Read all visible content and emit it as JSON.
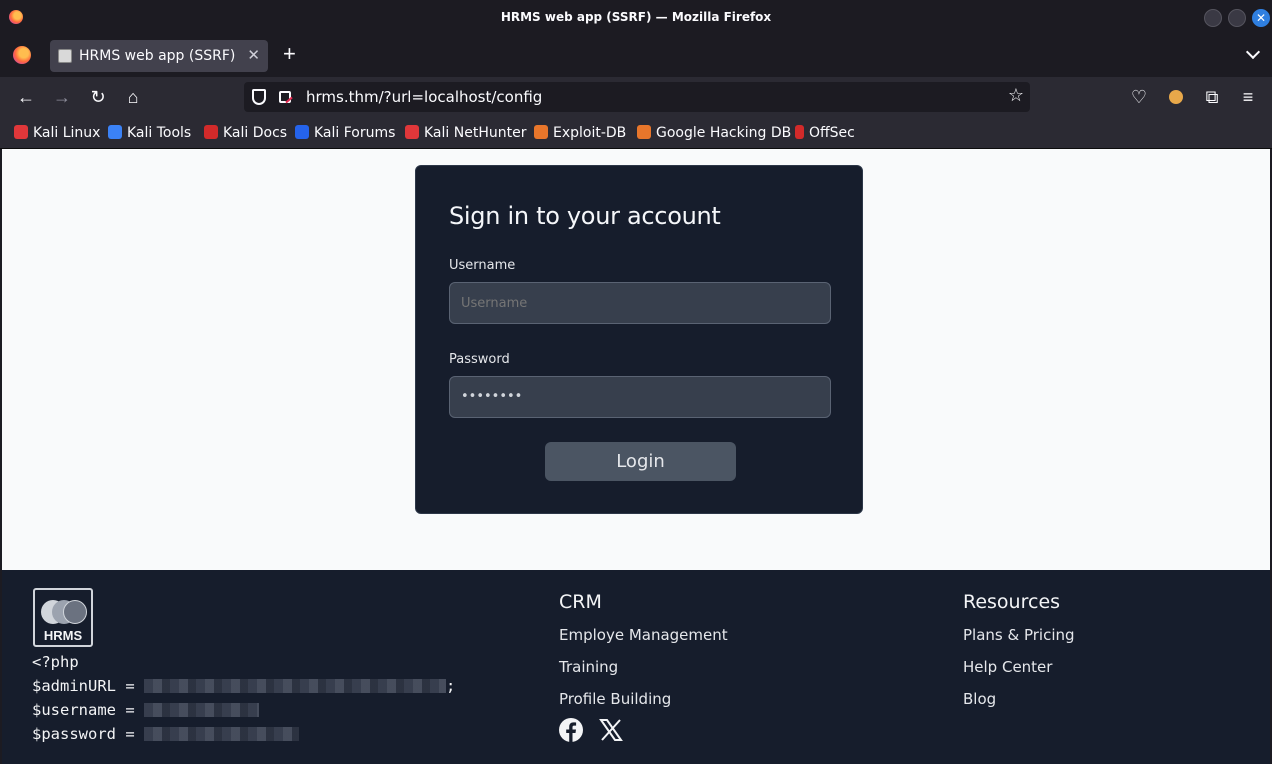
{
  "window": {
    "title": "HRMS web app (SSRF) — Mozilla Firefox",
    "close_glyph": "✕"
  },
  "tabs": [
    {
      "label": "HRMS web app (SSRF)",
      "close_glyph": "✕"
    }
  ],
  "toolbar": {
    "new_tab_glyph": "+",
    "back_glyph": "←",
    "forward_glyph": "→",
    "reload_glyph": "↻",
    "home_glyph": "⌂",
    "url": "hrms.thm/?url=localhost/config",
    "bookmark_star_glyph": "☆",
    "pocket_glyph": "♡",
    "extensions_glyph": "⧉",
    "menu_glyph": "≡"
  },
  "bookmarks": [
    {
      "label": "Kali Linux",
      "color": "#e0373a"
    },
    {
      "label": "Kali Tools",
      "color": "#3b82f6"
    },
    {
      "label": "Kali Docs",
      "color": "#d22a2a"
    },
    {
      "label": "Kali Forums",
      "color": "#2563eb"
    },
    {
      "label": "Kali NetHunter",
      "color": "#e0373a"
    },
    {
      "label": "Exploit-DB",
      "color": "#e8762b"
    },
    {
      "label": "Google Hacking DB",
      "color": "#e8762b"
    },
    {
      "label": "OffSec",
      "color": "#d22a2a"
    }
  ],
  "login": {
    "heading": "Sign in to your account",
    "username_label": "Username",
    "username_placeholder": "Username",
    "password_label": "Password",
    "password_value": "••••••••",
    "login_button": "Login"
  },
  "footer": {
    "logo_text": "HRMS",
    "code_lines": {
      "open": "<?php",
      "admin": "$adminURL = ",
      "admin_end": ";",
      "user": "$username = ",
      "pass": "$password = "
    },
    "crm": {
      "heading": "CRM",
      "links": [
        "Employe Management",
        "Training",
        "Profile Building"
      ]
    },
    "resources": {
      "heading": "Resources",
      "links": [
        "Plans & Pricing",
        "Help Center",
        "Blog"
      ]
    }
  }
}
